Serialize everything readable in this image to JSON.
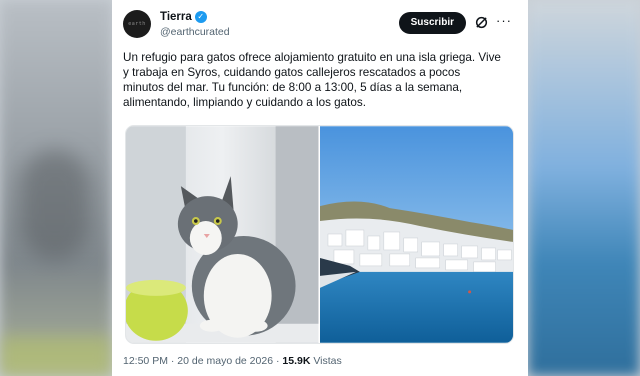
{
  "author": {
    "display_name": "Tierra",
    "handle": "@earthcurated",
    "avatar_text": "earth"
  },
  "actions": {
    "subscribe_label": "Suscribir"
  },
  "tweet": {
    "text": "Un refugio para gatos ofrece alojamiento gratuito en una isla griega. Vive\ny trabaja en Syros, cuidando gatos callejeros rescatados a pocos\nminutos del mar. Tu función: de 8:00 a 13:00, 5 días a la semana,\nalimentando, limpiando y cuidando a los gatos."
  },
  "meta": {
    "time": "12:50 PM",
    "separator1": " · ",
    "date": "20 de mayo de 2026",
    "separator2": " · ",
    "views_count": "15.9K",
    "views_label": " Vistas"
  },
  "media": {
    "images": [
      "cat-photo",
      "island-town-photo"
    ]
  },
  "colors": {
    "verified": "#1d9bf0",
    "text_primary": "#0f1419",
    "text_secondary": "#536471"
  }
}
